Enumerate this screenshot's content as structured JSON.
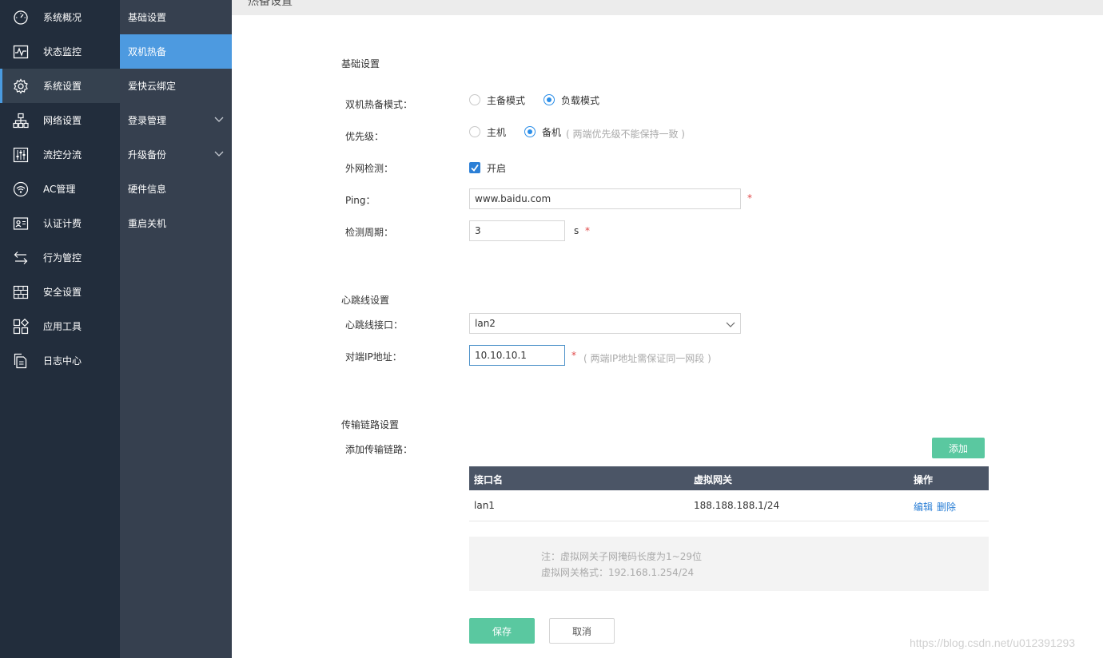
{
  "sidebar": {
    "items": [
      {
        "label": "系统概况",
        "icon": "dashboard-icon"
      },
      {
        "label": "状态监控",
        "icon": "monitor-icon"
      },
      {
        "label": "系统设置",
        "icon": "gear-icon",
        "active": true
      },
      {
        "label": "网络设置",
        "icon": "network-icon"
      },
      {
        "label": "流控分流",
        "icon": "sliders-icon"
      },
      {
        "label": "AC管理",
        "icon": "wifi-icon"
      },
      {
        "label": "认证计费",
        "icon": "id-card-icon"
      },
      {
        "label": "行为管控",
        "icon": "swap-icon"
      },
      {
        "label": "安全设置",
        "icon": "firewall-icon"
      },
      {
        "label": "应用工具",
        "icon": "apps-icon"
      },
      {
        "label": "日志中心",
        "icon": "document-icon"
      }
    ]
  },
  "subnav": {
    "items": [
      {
        "label": "基础设置"
      },
      {
        "label": "双机热备",
        "active": true
      },
      {
        "label": "爱快云绑定"
      },
      {
        "label": "登录管理",
        "expandable": true
      },
      {
        "label": "升级备份",
        "expandable": true
      },
      {
        "label": "硬件信息"
      },
      {
        "label": "重启关机"
      }
    ]
  },
  "page": {
    "title": "热备设置"
  },
  "basic": {
    "section_title": "基础设置",
    "mode_label": "双机热备模式：",
    "mode_options": [
      "主备模式",
      "负载模式"
    ],
    "mode_selected": "负载模式",
    "priority_label": "优先级：",
    "priority_options": [
      "主机",
      "备机"
    ],
    "priority_selected": "备机",
    "priority_hint": "( 两端优先级不能保持一致 )",
    "wan_check_label": "外网检测：",
    "wan_check_option": "开启",
    "wan_check_enabled": true,
    "ping_label": "Ping：",
    "ping_value": "www.baidu.com",
    "interval_label": "检测周期：",
    "interval_value": "3",
    "interval_unit": "s",
    "required_mark": "*"
  },
  "heartbeat": {
    "section_title": "心跳线设置",
    "iface_label": "心跳线接口：",
    "iface_value": "lan2",
    "peer_ip_label": "对端IP地址：",
    "peer_ip_value": "10.10.10.1",
    "peer_ip_hint": "( 两端IP地址需保证同一网段 )",
    "required_mark": "*"
  },
  "transport": {
    "section_title": "传输链路设置",
    "add_label": "添加传输链路：",
    "add_button": "添加",
    "columns": [
      "接口名",
      "虚拟网关",
      "操作"
    ],
    "rows": [
      {
        "iface": "lan1",
        "gateway": "188.188.188.1/24",
        "edit": "编辑",
        "delete": "删除"
      }
    ],
    "note_line1": "注：虚拟网关子网掩码长度为1~29位",
    "note_line2": "虚拟网关格式：192.168.1.254/24"
  },
  "actions": {
    "save": "保存",
    "cancel": "取消"
  },
  "watermark": "https://blog.csdn.net/u012391293",
  "colors": {
    "sidebar_bg": "#222d3c",
    "subnav_bg": "#36404f",
    "subnav_active": "#4d9ae0",
    "primary_button": "#5ac8a0",
    "link": "#2b7fd6",
    "table_header": "#4b5566"
  }
}
